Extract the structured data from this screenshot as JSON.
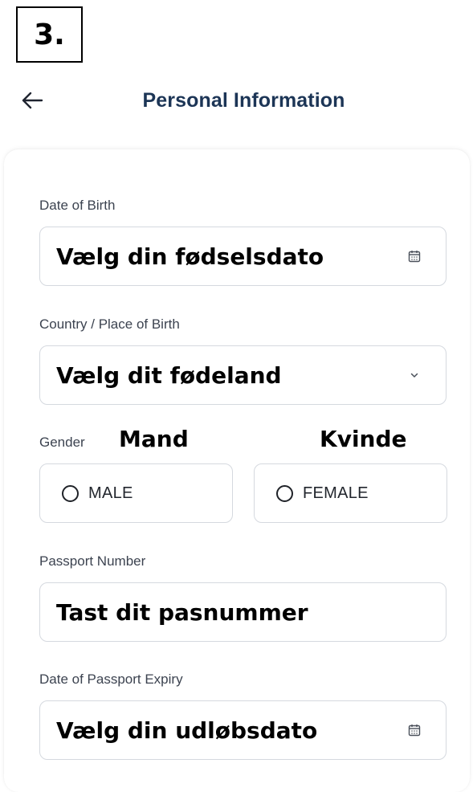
{
  "step_badge": "3.",
  "header": {
    "title": "Personal Information"
  },
  "fields": {
    "dob": {
      "label": "Date of Birth",
      "overlay": "Vælg din fødselsdato"
    },
    "country": {
      "label": "Country / Place of Birth",
      "overlay": "Vælg dit fødeland"
    },
    "gender": {
      "label": "Gender",
      "male": "MALE",
      "female": "FEMALE",
      "male_overlay": "Mand",
      "female_overlay": "Kvinde"
    },
    "passport": {
      "label": "Passport Number",
      "overlay": "Tast dit pasnummer"
    },
    "expiry": {
      "label": "Date of Passport Expiry",
      "overlay": "Vælg din udløbsdato"
    }
  },
  "colors": {
    "title": "#1c3556",
    "border": "#d5d9df",
    "label": "#3c4350"
  },
  "icons": {
    "back": "arrow-left-icon",
    "calendar": "calendar-icon",
    "chevron": "chevron-down-icon",
    "radio": "radio-empty-icon"
  }
}
